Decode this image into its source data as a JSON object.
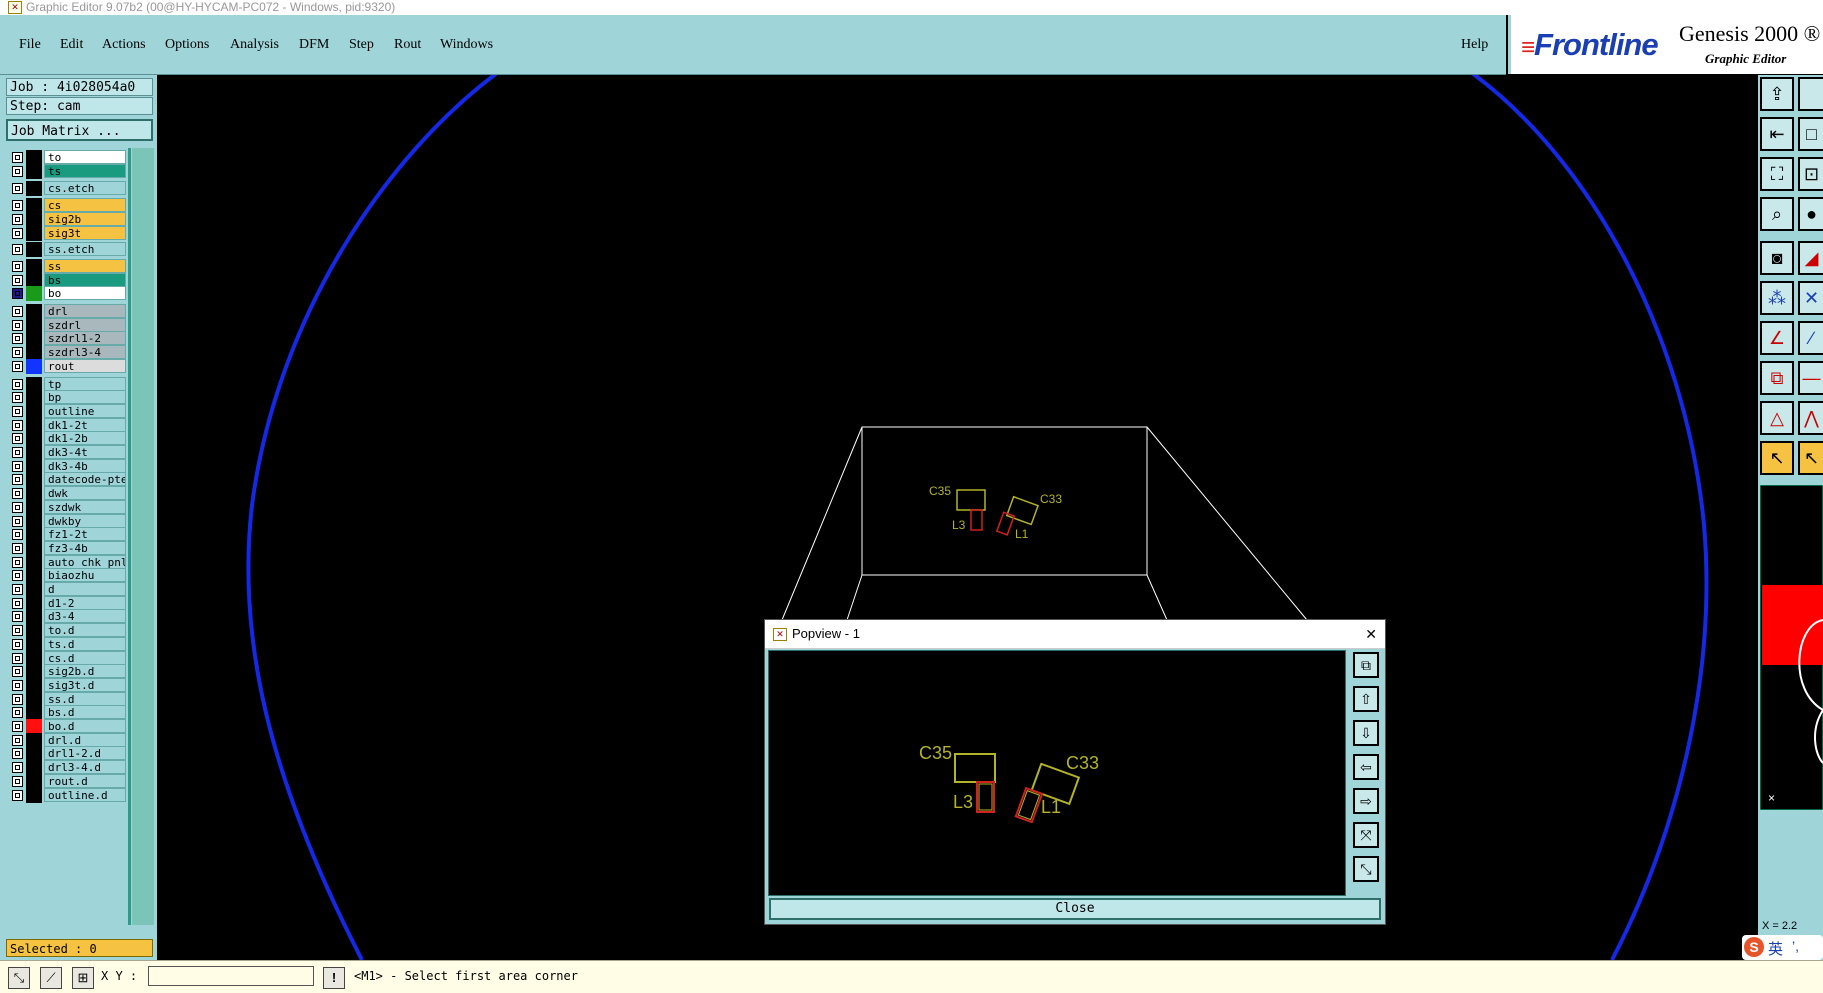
{
  "window": {
    "title": "Graphic Editor 9.07b2 (00@HY-HYCAM-PC072 - Windows, pid:9320)"
  },
  "menu": [
    "File",
    "Edit",
    "Actions",
    "Options",
    "Analysis",
    "DFM",
    "Step",
    "Rout",
    "Windows"
  ],
  "help_label": "Help",
  "brand": {
    "logo": "Frontline",
    "product": "Genesis 2000 ®",
    "subtitle": "Graphic Editor"
  },
  "job": {
    "job_label": "Job : 4i028054a0",
    "step_label": "Step: cam",
    "matrix_button": "Job Matrix ..."
  },
  "layers": [
    {
      "name": "to",
      "color": "#ffffff"
    },
    {
      "name": "ts",
      "color": "#1a9a7e"
    },
    {
      "name": "cs.etch",
      "color": "#9fd5d9"
    },
    {
      "name": "cs",
      "color": "#f5c242"
    },
    {
      "name": "sig2b",
      "color": "#f5c242"
    },
    {
      "name": "sig3t",
      "color": "#f5c242"
    },
    {
      "name": "ss.etch",
      "color": "#9fd5d9"
    },
    {
      "name": "ss",
      "color": "#f5c242"
    },
    {
      "name": "bs",
      "color": "#1a9a7e"
    },
    {
      "name": "bo",
      "color": "#ffffff",
      "swatch": "#1a9a1a",
      "active": true
    },
    {
      "name": "drl",
      "color": "#a8b8bc"
    },
    {
      "name": "szdrl",
      "color": "#a8b8bc"
    },
    {
      "name": "szdrl1-2",
      "color": "#a8b8bc"
    },
    {
      "name": "szdrl3-4",
      "color": "#a8b8bc"
    },
    {
      "name": "rout",
      "color": "#dcdcdc",
      "swatch": "#1234ff"
    },
    {
      "name": "tp",
      "color": "#9fd5d9"
    },
    {
      "name": "bp",
      "color": "#9fd5d9"
    },
    {
      "name": "outline",
      "color": "#9fd5d9"
    },
    {
      "name": "dk1-2t",
      "color": "#9fd5d9"
    },
    {
      "name": "dk1-2b",
      "color": "#9fd5d9"
    },
    {
      "name": "dk3-4t",
      "color": "#9fd5d9"
    },
    {
      "name": "dk3-4b",
      "color": "#9fd5d9"
    },
    {
      "name": "datecode-pte",
      "color": "#9fd5d9"
    },
    {
      "name": "dwk",
      "color": "#9fd5d9"
    },
    {
      "name": "szdwk",
      "color": "#9fd5d9"
    },
    {
      "name": "dwkby",
      "color": "#9fd5d9"
    },
    {
      "name": "fz1-2t",
      "color": "#9fd5d9"
    },
    {
      "name": "fz3-4b",
      "color": "#9fd5d9"
    },
    {
      "name": "auto_chk_pnl",
      "color": "#9fd5d9"
    },
    {
      "name": "biaozhu",
      "color": "#9fd5d9"
    },
    {
      "name": "d",
      "color": "#9fd5d9"
    },
    {
      "name": "d1-2",
      "color": "#9fd5d9"
    },
    {
      "name": "d3-4",
      "color": "#9fd5d9"
    },
    {
      "name": "to.d",
      "color": "#9fd5d9"
    },
    {
      "name": "ts.d",
      "color": "#9fd5d9"
    },
    {
      "name": "cs.d",
      "color": "#9fd5d9"
    },
    {
      "name": "sig2b.d",
      "color": "#9fd5d9"
    },
    {
      "name": "sig3t.d",
      "color": "#9fd5d9"
    },
    {
      "name": "ss.d",
      "color": "#9fd5d9"
    },
    {
      "name": "bs.d",
      "color": "#9fd5d9"
    },
    {
      "name": "bo.d",
      "color": "#9fd5d9",
      "swatch": "#ff1010"
    },
    {
      "name": "drl.d",
      "color": "#9fd5d9"
    },
    {
      "name": "drl1-2.d",
      "color": "#9fd5d9"
    },
    {
      "name": "drl3-4.d",
      "color": "#9fd5d9"
    },
    {
      "name": "rout.d",
      "color": "#9fd5d9"
    },
    {
      "name": "outline.d",
      "color": "#9fd5d9"
    }
  ],
  "selected_label": "Selected : 0",
  "status": {
    "xy_label": "X Y :",
    "xy_value": "",
    "prompt": "<M1> - Select first area corner",
    "warn_icon": "!"
  },
  "canvas": {
    "labels": {
      "c35": "C35",
      "c33": "C33",
      "l3": "L3",
      "l1": "L1"
    },
    "ime": {
      "icon": "S",
      "text": "英",
      "punct": "’,"
    },
    "x_readout": "X = 2.2"
  },
  "popview": {
    "title": "Popview - 1",
    "close_label": "Close",
    "close_x": "✕"
  },
  "colors": {
    "accent": "#9fd5d9",
    "outline_blue": "#1428e6",
    "component_olive": "#b3b32a",
    "pad_red": "#d02020"
  }
}
